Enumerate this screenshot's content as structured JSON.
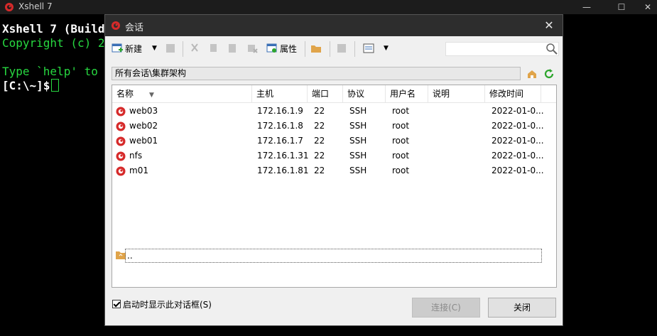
{
  "terminal": {
    "title": "Xshell 7",
    "lines": [
      "Xshell 7 (Build",
      "Copyright (c) 2",
      "Type `help' to",
      "[C:\\~]$"
    ],
    "controls": {
      "minimize": "—",
      "maximize": "☐",
      "close": "✕"
    }
  },
  "dialog": {
    "title": "会话",
    "toolbar": {
      "new_label": "新建",
      "properties_label": "属性"
    },
    "path": "所有会话\\集群架构",
    "columns": [
      "名称",
      "主机",
      "端口",
      "协议",
      "用户名",
      "说明",
      "修改时间"
    ],
    "sessions": [
      {
        "name": "web03",
        "host": "172.16.1.9",
        "port": "22",
        "protocol": "SSH",
        "user": "root",
        "desc": "",
        "modified": "2022-01-0..."
      },
      {
        "name": "web02",
        "host": "172.16.1.8",
        "port": "22",
        "protocol": "SSH",
        "user": "root",
        "desc": "",
        "modified": "2022-01-0..."
      },
      {
        "name": "web01",
        "host": "172.16.1.7",
        "port": "22",
        "protocol": "SSH",
        "user": "root",
        "desc": "",
        "modified": "2022-01-0..."
      },
      {
        "name": "nfs",
        "host": "172.16.1.31",
        "port": "22",
        "protocol": "SSH",
        "user": "root",
        "desc": "",
        "modified": "2022-01-0..."
      },
      {
        "name": "m01",
        "host": "172.16.1.81",
        "port": "22",
        "protocol": "SSH",
        "user": "root",
        "desc": "",
        "modified": "2022-01-0..."
      }
    ],
    "parent_item": "..",
    "startup_checkbox": "启动时显示此对话框(S)",
    "connect_button": "连接(C)",
    "close_button": "关闭"
  },
  "colors": {
    "accent_red": "#d62a2a",
    "terminal_green": "#27d840",
    "terminal_bg": "#000000"
  }
}
